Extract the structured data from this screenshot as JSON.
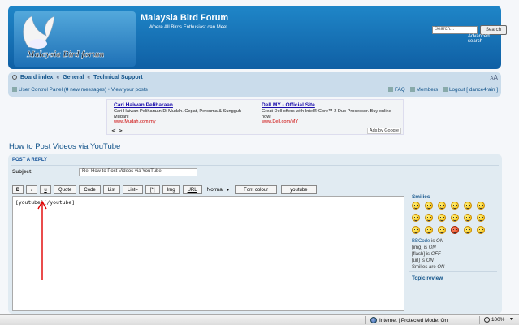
{
  "header": {
    "logo_text": "Malaysia Bird forum",
    "title": "Malaysia Bird Forum",
    "description": "Where All Birds Enthusiast can Meet",
    "search_placeholder": "Search...",
    "search_button": "Search",
    "advanced_search": "Advanced search"
  },
  "navbar": {
    "breadcrumbs": [
      "Board index",
      "General",
      "Technical Support"
    ],
    "separator": "«",
    "ucp": "User Control Panel",
    "new_messages_count": "0",
    "new_messages_label": "new messages",
    "view_posts": "View your posts",
    "faq": "FAQ",
    "members": "Members",
    "logout": "Logout [ dance4rain ]"
  },
  "ads": [
    {
      "title": "Cari Haiwan Peliharaan",
      "text": "Cari Haiwan Peliharaan Di Mudah. Cepat, Percuma & Sungguh Mudah!",
      "url": "www.Mudah.com.my"
    },
    {
      "title": "Dell MY - Official Site",
      "text": "Great Dell offers with Intel® Core™ 2 Duo Processor. Buy online now!",
      "url": "www.Dell.com/MY"
    }
  ],
  "ads_nav": "< >",
  "ads_by": "Ads by Google",
  "topic": {
    "title": "How to Post Videos via YouTube"
  },
  "post": {
    "heading": "POST A REPLY",
    "subject_label": "Subject:",
    "subject_value": "Re: How to Post Videos via YouTube",
    "toolbar": [
      "B",
      "i",
      "u",
      "Quote",
      "Code",
      "List",
      "List=",
      "[*]",
      "Img",
      "URL"
    ],
    "font_size": "Normal",
    "font_colour": "Font colour",
    "youtube": "youtube",
    "message": "[youtube][/youtube]"
  },
  "sidebar": {
    "smilies_label": "Smilies",
    "bbcode_status": [
      {
        "name": "BBCode",
        "state": "ON"
      },
      {
        "name": "[img]",
        "state": "ON"
      },
      {
        "name": "[flash]",
        "state": "OFF"
      },
      {
        "name": "[url]",
        "state": "ON"
      },
      {
        "name": "Smilies",
        "state": "ON"
      }
    ],
    "topic_review": "Topic review"
  },
  "statusbar": {
    "zone": "Internet | Protected Mode: On",
    "zoom": "100%"
  },
  "colors": {
    "header_gradient_top": "#1f86c8",
    "header_gradient_bottom": "#0f5fa4",
    "link": "#105289",
    "panel_bg": "#e1ebf2",
    "annotation_arrow": "#e00000"
  }
}
